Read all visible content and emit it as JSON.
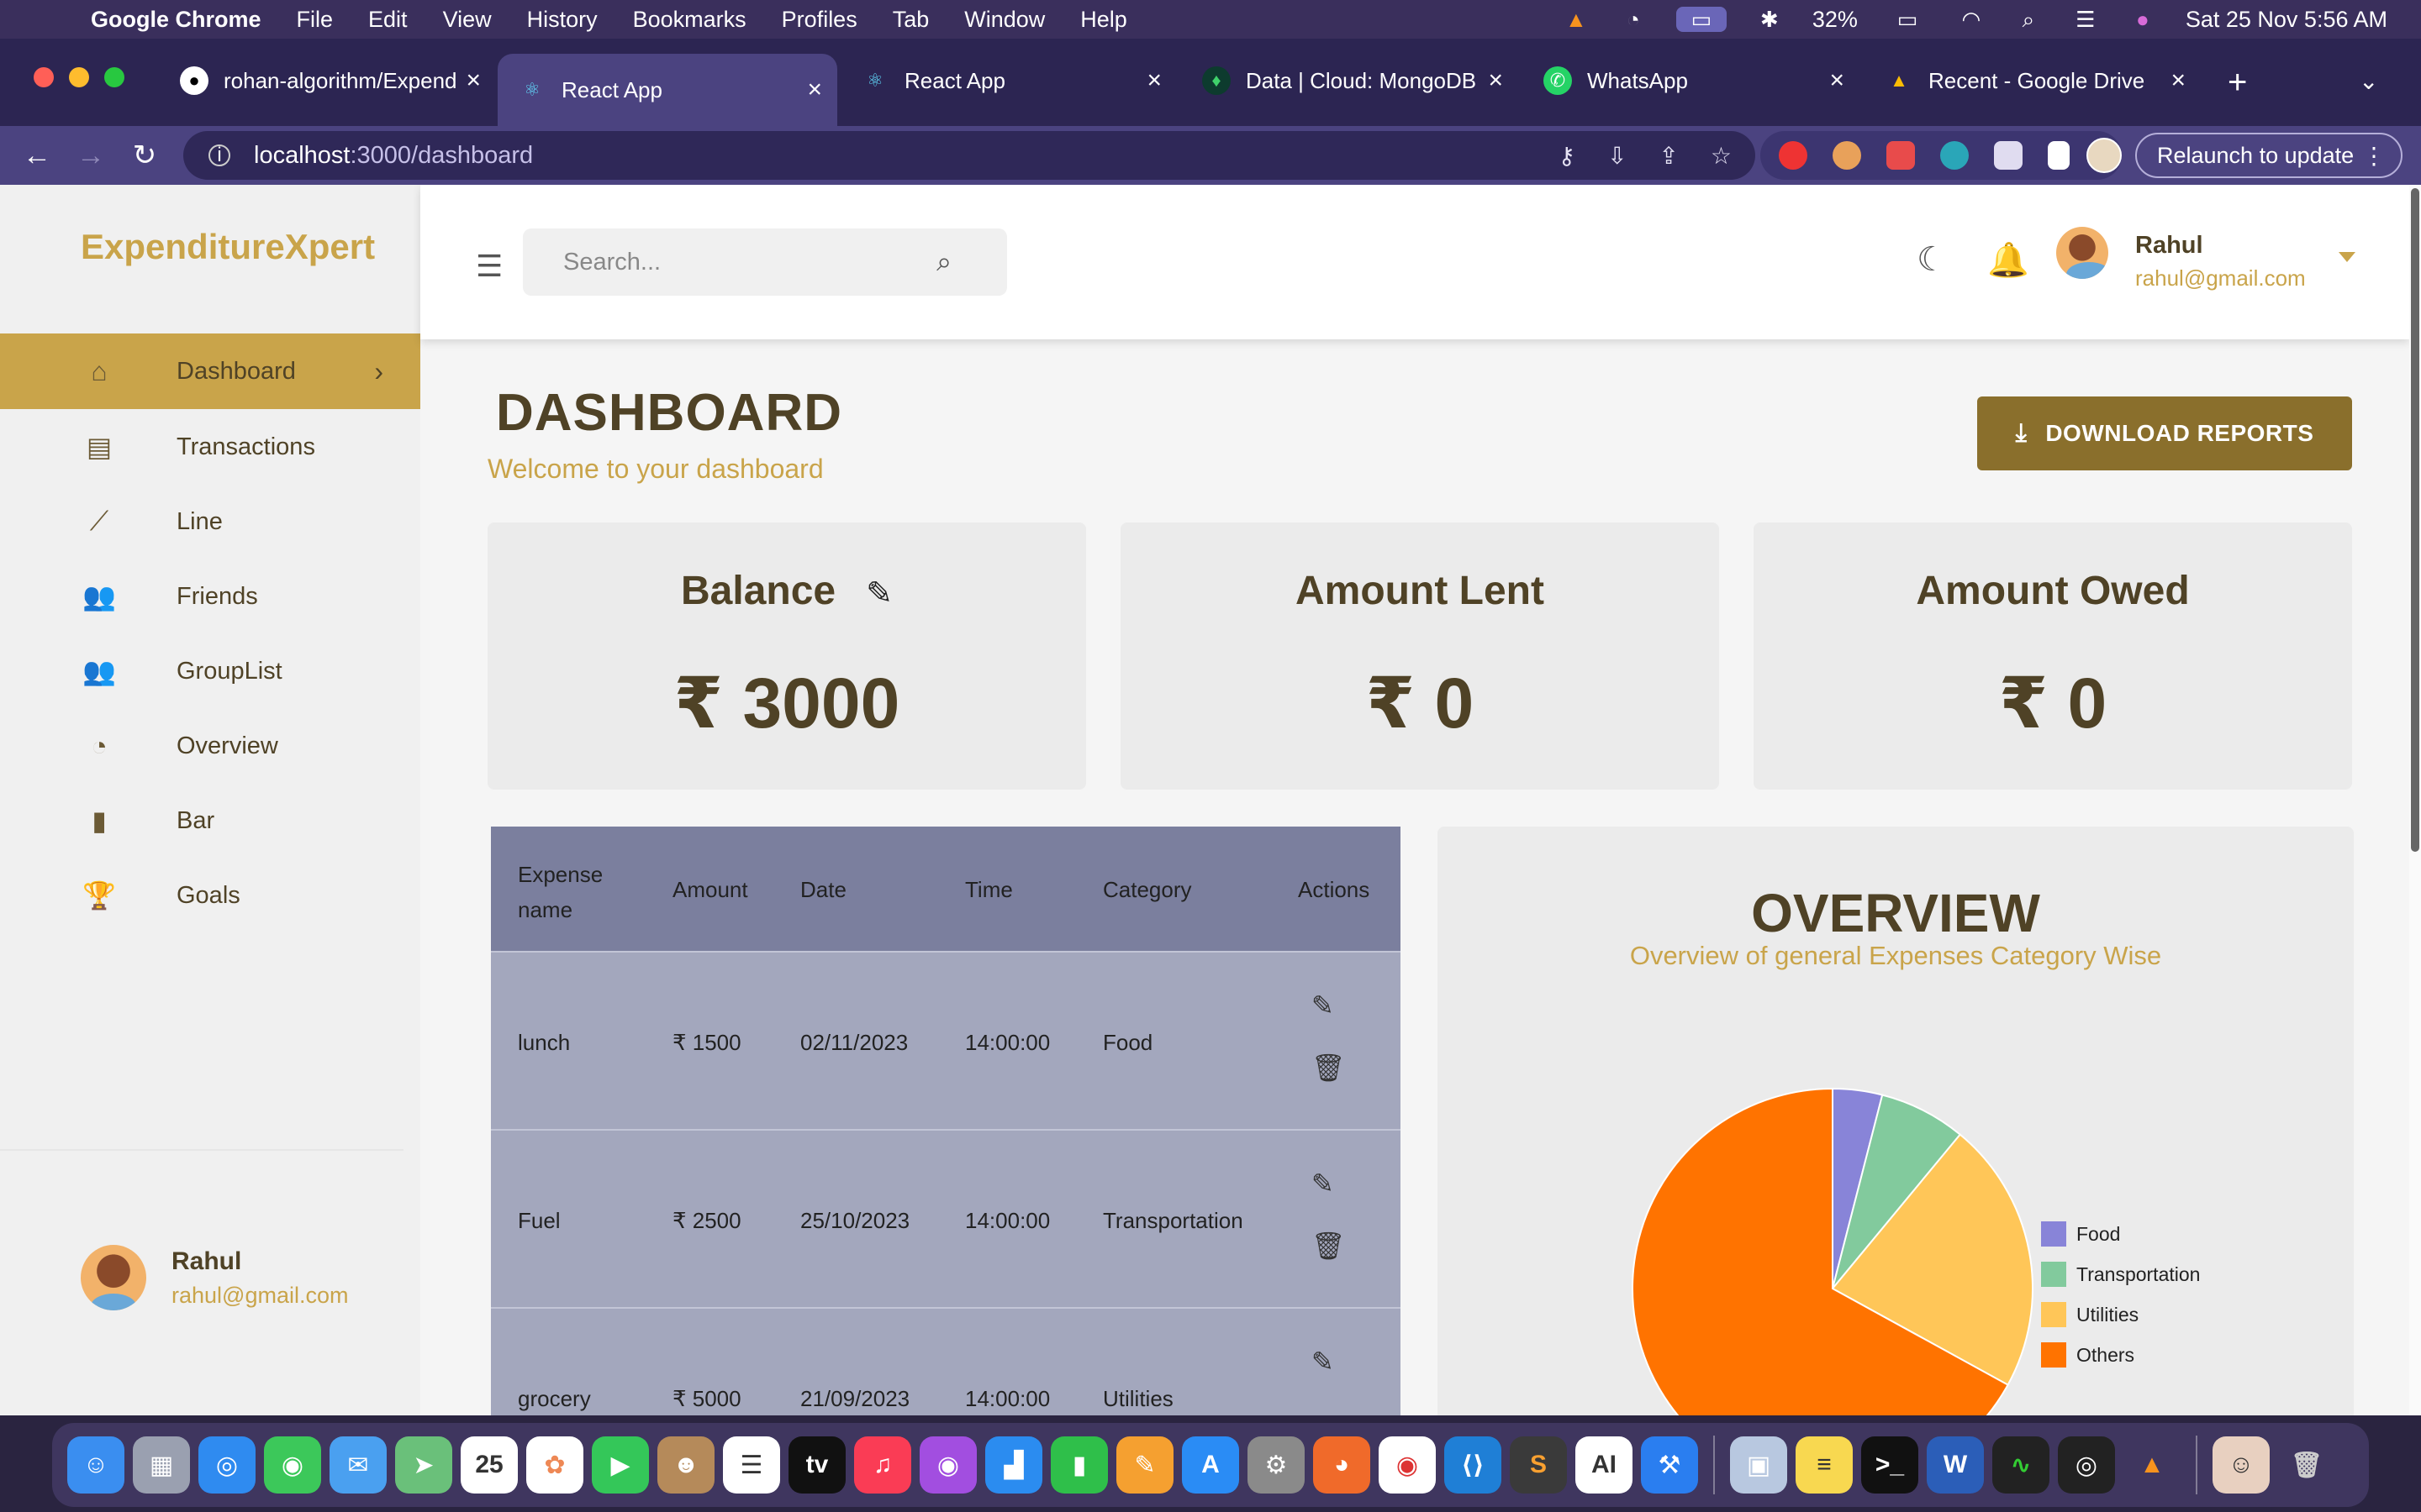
{
  "menubar": {
    "app_name": "Google Chrome",
    "items": [
      "File",
      "Edit",
      "View",
      "History",
      "Bookmarks",
      "Profiles",
      "Tab",
      "Window",
      "Help"
    ],
    "battery": "32%",
    "datetime": "Sat 25 Nov  5:56 AM"
  },
  "browser": {
    "tabs": [
      {
        "title": "rohan-algorithm/Expend",
        "favicon": "github-icon"
      },
      {
        "title": "React App",
        "favicon": "react-icon",
        "active": true
      },
      {
        "title": "React App",
        "favicon": "react-icon"
      },
      {
        "title": "Data | Cloud: MongoDB",
        "favicon": "mongodb-icon"
      },
      {
        "title": "WhatsApp",
        "favicon": "whatsapp-icon"
      },
      {
        "title": "Recent - Google Drive",
        "favicon": "drive-icon"
      }
    ],
    "url_host": "localhost",
    "url_path": ":3000/dashboard",
    "relaunch_label": "Relaunch to update"
  },
  "sidebar": {
    "brand": "ExpenditureXpert",
    "items": [
      {
        "label": "Dashboard",
        "icon": "home-icon"
      },
      {
        "label": "Transactions",
        "icon": "receipt-icon"
      },
      {
        "label": "Line",
        "icon": "line-chart-icon"
      },
      {
        "label": "Friends",
        "icon": "people-icon"
      },
      {
        "label": "GroupList",
        "icon": "group-icon"
      },
      {
        "label": "Overview",
        "icon": "pie-chart-icon"
      },
      {
        "label": "Bar",
        "icon": "bar-chart-icon"
      },
      {
        "label": "Goals",
        "icon": "trophy-icon"
      }
    ],
    "user": {
      "name": "Rahul",
      "email": "rahul@gmail.com"
    }
  },
  "header": {
    "search_placeholder": "Search...",
    "user_name": "Rahul",
    "user_email": "rahul@gmail.com"
  },
  "dashboard": {
    "title": "DASHBOARD",
    "subtitle": "Welcome to your dashboard",
    "download_label": "DOWNLOAD REPORTS",
    "cards": [
      {
        "label": "Balance",
        "value": "₹ 3000"
      },
      {
        "label": "Amount Lent",
        "value": "₹ 0"
      },
      {
        "label": "Amount Owed",
        "value": "₹ 0"
      }
    ]
  },
  "table": {
    "headers": [
      "Expense name",
      "Amount",
      "Date",
      "Time",
      "Category",
      "Actions"
    ],
    "rows": [
      {
        "name": "lunch",
        "amount": "₹ 1500",
        "date": "02/11/2023",
        "time": "14:00:00",
        "category": "Food"
      },
      {
        "name": "Fuel",
        "amount": "₹ 2500",
        "date": "25/10/2023",
        "time": "14:00:00",
        "category": "Transportation"
      },
      {
        "name": "grocery",
        "amount": "₹ 5000",
        "date": "21/09/2023",
        "time": "14:00:00",
        "category": "Utilities"
      }
    ]
  },
  "overview": {
    "title": "OVERVIEW",
    "subtitle": "Overview of general Expenses Category Wise"
  },
  "chart_data": {
    "type": "pie",
    "categories": [
      "Food",
      "Transportation",
      "Utilities",
      "Others"
    ],
    "values": [
      4,
      7,
      22,
      67
    ],
    "colors": [
      "#8884d8",
      "#82ca9d",
      "#ffc658",
      "#ff7300"
    ],
    "legend": "right"
  }
}
